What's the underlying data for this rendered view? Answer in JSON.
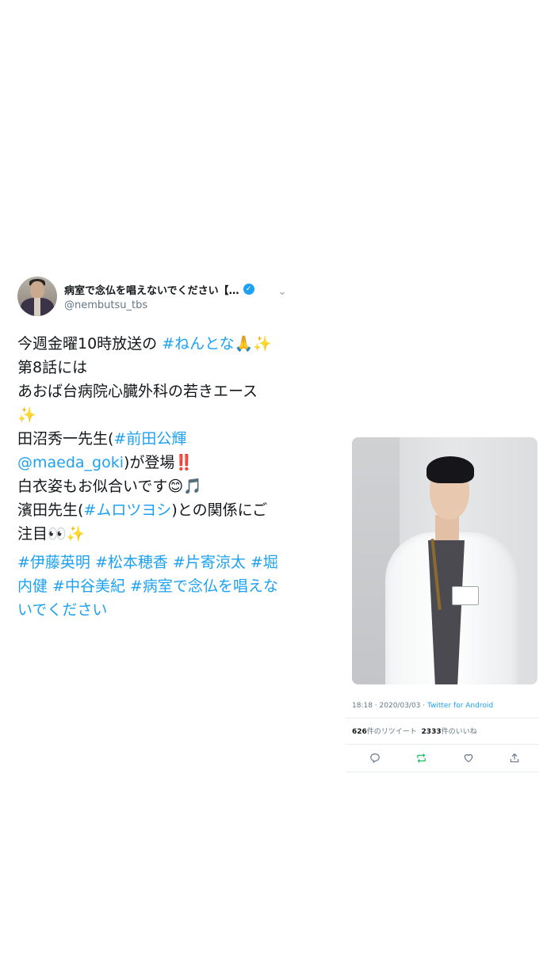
{
  "tweet": {
    "display_name": "病室で念仏を唱えないでください【…",
    "handle": "@nembutsu_tbs",
    "lines": [
      {
        "pre": "今週金曜10時放送の ",
        "link": "#ねんとな",
        "post": "🙏✨"
      },
      {
        "pre": "第8話には",
        "link": "",
        "post": ""
      },
      {
        "pre": "あおば台病院心臓外科の若きエース",
        "link": "",
        "post": ""
      },
      {
        "pre": "✨",
        "link": "",
        "post": ""
      },
      {
        "pre": "田沼秀一先生(",
        "link": "#前田公輝",
        "post": ""
      },
      {
        "pre": "",
        "link": "@maeda_goki",
        "post": ")が登場‼️"
      },
      {
        "pre": "白衣姿もお似合いです😊🎵",
        "link": "",
        "post": ""
      },
      {
        "pre": "濱田先生(",
        "link": "#ムロツヨシ",
        "post": ")との関係にご"
      },
      {
        "pre": "注目👀✨",
        "link": "",
        "post": ""
      }
    ],
    "hashtags": "#伊藤英明 #松本穂香 #片寄涼太 #堀内健 #中谷美紀 #病室で念仏を唱えないでください"
  },
  "detail": {
    "time": "18:18",
    "date": "2020/03/03",
    "source": "Twitter for Android",
    "retweets": "626",
    "retweets_label": "件のリツイート",
    "likes": "2333",
    "likes_label": "件のいいね"
  },
  "icons": {
    "verified": "verified-badge-icon",
    "chevron": "chevron-down-icon",
    "reply": "reply-icon",
    "retweet": "retweet-icon",
    "like": "heart-icon",
    "share": "share-icon"
  },
  "colors": {
    "link": "#1da1f2",
    "retweet_active": "#17bf63",
    "muted": "#657786"
  }
}
